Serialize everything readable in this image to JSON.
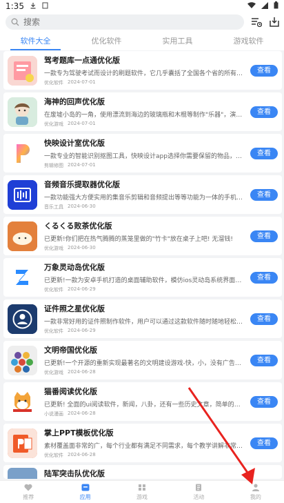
{
  "status_bar": {
    "time": "1:35"
  },
  "search": {
    "placeholder": "搜索"
  },
  "tabs": [
    {
      "label": "软件大全",
      "active": true
    },
    {
      "label": "优化软件",
      "active": false
    },
    {
      "label": "实用工具",
      "active": false
    },
    {
      "label": "游戏软件",
      "active": false
    }
  ],
  "view_label": "查看",
  "apps": [
    {
      "title": "驾考题库一点通优化版",
      "desc": "一款专为驾驶考试而设计的刷题软件，它几乎囊括了全国各个省的所有驾考",
      "category": "优化软件",
      "date": "2024-07-01",
      "icon": "book-icon",
      "color": "#f6c9c9"
    },
    {
      "title": "海神的回声优化版",
      "desc": "在废墟小岛的一角，使用漂流到海边的玻璃瓶和木棍等制作\"乐器\"，演奏听到",
      "category": "优化游戏",
      "date": "2024-07-01",
      "icon": "character-icon",
      "color": "#cfe6d9"
    },
    {
      "title": "快映设计室优化版",
      "desc": "一款专业的智能识别抠图工具，快映设计app选择你需要保留的物品，即可进",
      "category": "剪辑修图",
      "date": "2024-07-01",
      "icon": "p-logo-icon",
      "color": "#ffffff"
    },
    {
      "title": "音频音乐提取器优化版",
      "desc": "一款功能强大方便实用的集音乐剪辑和音频提出等等功能为一体的手机软件，",
      "category": "音乐工具",
      "date": "2024-06-30",
      "icon": "audio-icon",
      "color": "#1f3fd6"
    },
    {
      "title": "くるくる败茶优化版",
      "desc": "已更新!你们把在热气腾腾的蒸笼里做的\"竹卡\"放在桌子上吧! 无溜钱!",
      "category": "优化游戏",
      "date": "2024-06-30",
      "icon": "bun-icon",
      "color": "#e3803c"
    },
    {
      "title": "万象灵动岛优化版",
      "desc": "已更新!一款为安卓手机打造的桌面辅助软件，模仿ios灵动岛系统界面，功能",
      "category": "优化软件",
      "date": "2024-06-29",
      "icon": "z-logo-icon",
      "color": "#ffffff"
    },
    {
      "title": "证件照之星优化版",
      "desc": "一款非常好用的证件照制作软件，用户可以通过这款软件随时随地轻松制作证",
      "category": "优化软件",
      "date": "2024-06-29",
      "icon": "portrait-icon",
      "color": "#1c3b6e"
    },
    {
      "title": "文明帝国优化版",
      "desc": "已更新!一个开源的重新实现最著名的文明建设游戏-快，小，没有广告，无",
      "category": "优化游戏",
      "date": "2024-06-28",
      "icon": "hex-icon",
      "color": "#eeeeee"
    },
    {
      "title": "猫番阅读优化版",
      "desc": "已更新! 全面的ui阅读软件，新闻，八卦，还有一些历史文章，简单的UI页",
      "category": "小说漫画",
      "date": "2024-06-28",
      "icon": "cat-icon",
      "color": "#ffffff"
    },
    {
      "title": "掌上PPT模板优化版",
      "desc": "素材覆盖面非常的广，每个行业都有满足不同需求，每个教学讲解非常的通俗",
      "category": "优化软件",
      "date": "2024-06-28",
      "icon": "ppt-icon",
      "color": "#f05a28"
    },
    {
      "title": "陆军突击队优化版",
      "desc": "",
      "category": "",
      "date": "",
      "icon": "soldier-icon",
      "color": "#7aa0c9"
    }
  ],
  "bottom_nav": [
    {
      "label": "推荐",
      "icon": "heart-icon",
      "active": false
    },
    {
      "label": "应用",
      "icon": "apps-icon",
      "active": true
    },
    {
      "label": "游戏",
      "icon": "gamepad-icon",
      "active": false
    },
    {
      "label": "活动",
      "icon": "document-icon",
      "active": false
    },
    {
      "label": "我的",
      "icon": "person-icon",
      "active": false
    }
  ],
  "accent_color": "#3a86f4"
}
